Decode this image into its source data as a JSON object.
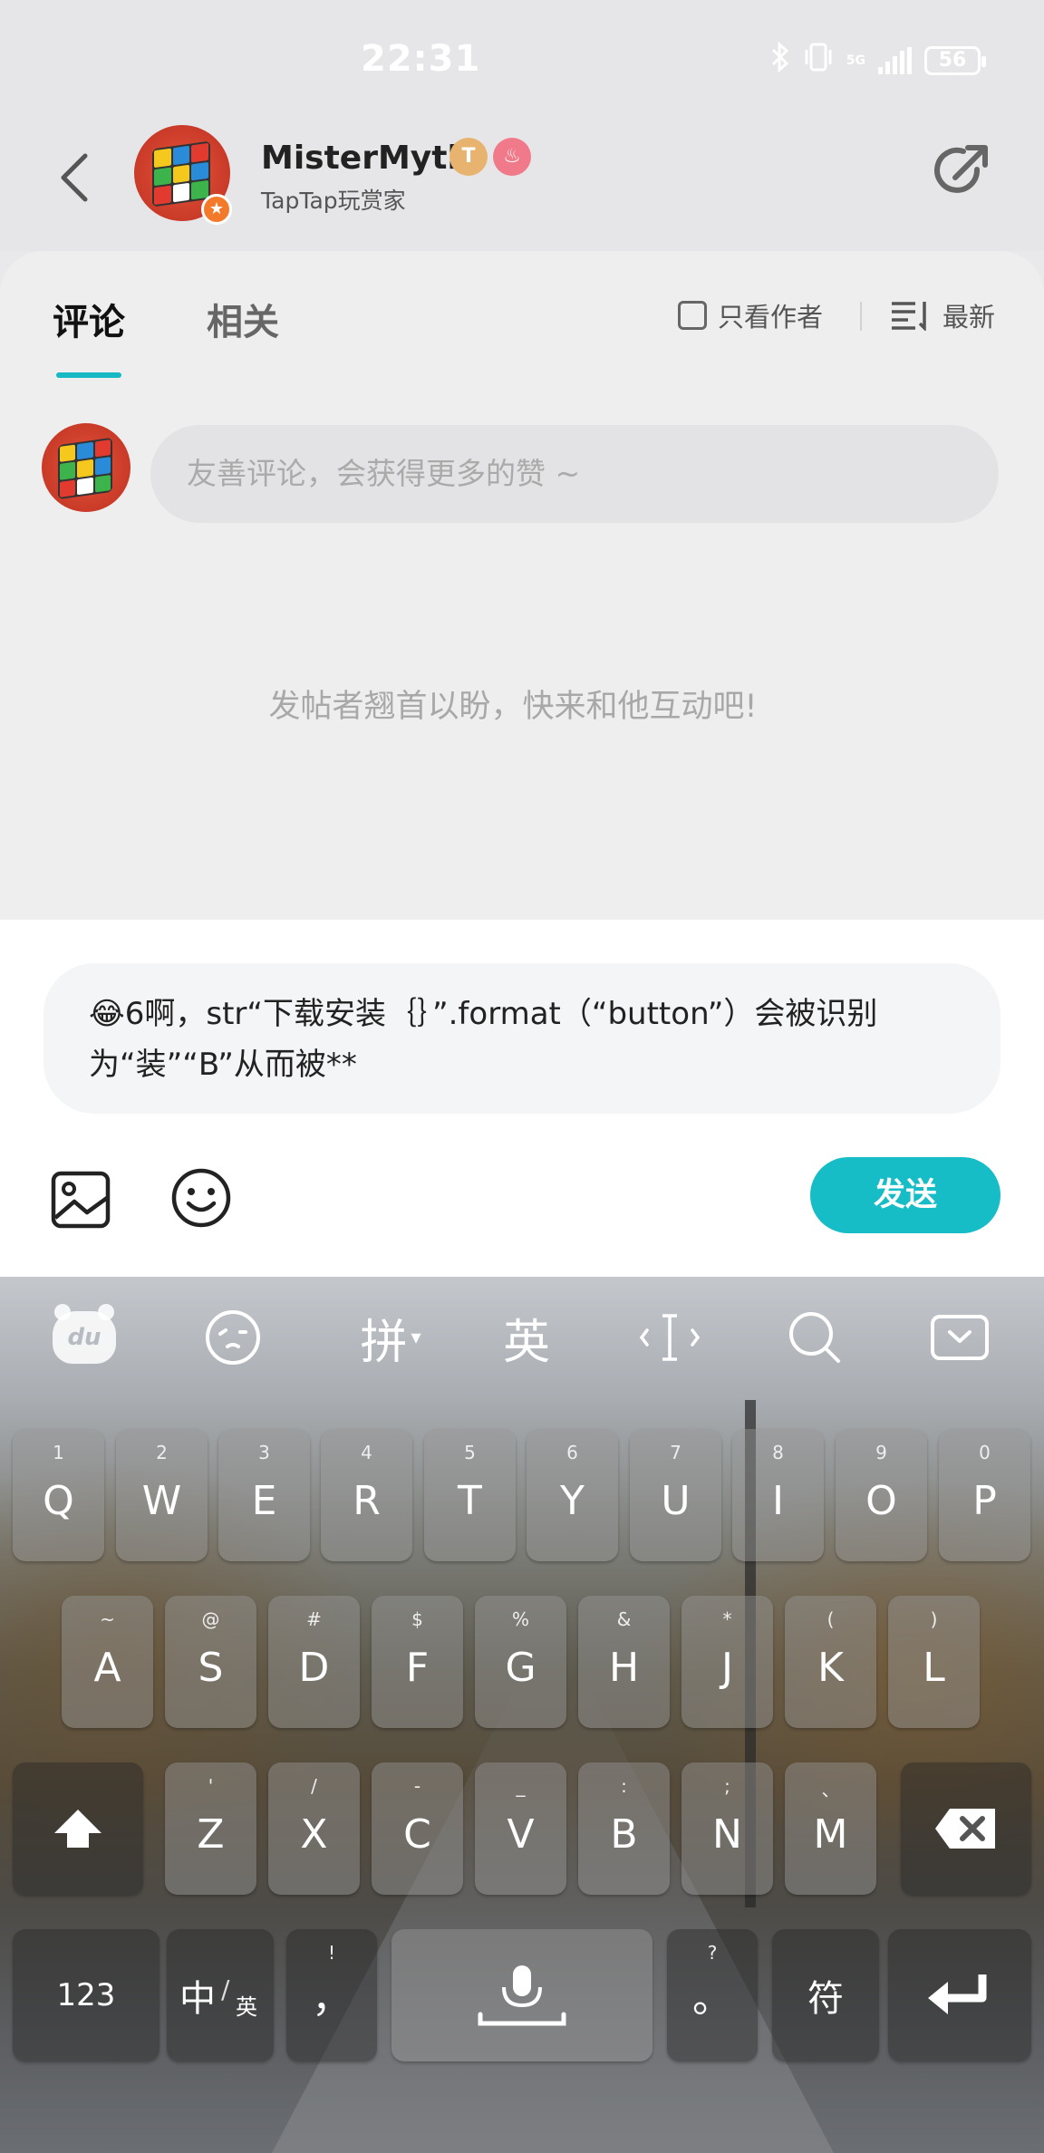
{
  "status_bar": {
    "time": "22:31",
    "network": "5G",
    "battery": "56"
  },
  "header": {
    "username": "MisterMyth",
    "subtitle": "TapTap玩赏家",
    "badge_t": "T",
    "badge_fire": "♨"
  },
  "tabs": {
    "comment": "评论",
    "related": "相关"
  },
  "filters": {
    "only_author": "只看作者",
    "sort": "最新"
  },
  "comment_box": {
    "placeholder": "友善评论，会获得更多的赞 ~"
  },
  "empty_hint": "发帖者翘首以盼，快来和他互动吧!",
  "compose": {
    "text": "😂6啊，str“下载安装｛｝”.format（“button”）会被识别为“装”“B”从而被**",
    "send_label": "发送"
  },
  "keyboard": {
    "toolbar": {
      "du": "du",
      "pinyin": "拼",
      "english": "英"
    },
    "row1": [
      {
        "sub": "1",
        "main": "Q"
      },
      {
        "sub": "2",
        "main": "W"
      },
      {
        "sub": "3",
        "main": "E"
      },
      {
        "sub": "4",
        "main": "R"
      },
      {
        "sub": "5",
        "main": "T"
      },
      {
        "sub": "6",
        "main": "Y"
      },
      {
        "sub": "7",
        "main": "U"
      },
      {
        "sub": "8",
        "main": "I"
      },
      {
        "sub": "9",
        "main": "O"
      },
      {
        "sub": "0",
        "main": "P"
      }
    ],
    "row2": [
      {
        "sub": "~",
        "main": "A"
      },
      {
        "sub": "@",
        "main": "S"
      },
      {
        "sub": "#",
        "main": "D"
      },
      {
        "sub": "$",
        "main": "F"
      },
      {
        "sub": "%",
        "main": "G"
      },
      {
        "sub": "&",
        "main": "H"
      },
      {
        "sub": "*",
        "main": "J"
      },
      {
        "sub": "(",
        "main": "K"
      },
      {
        "sub": ")",
        "main": "L"
      }
    ],
    "row3": [
      {
        "sub": "'",
        "main": "Z"
      },
      {
        "sub": "/",
        "main": "X"
      },
      {
        "sub": "-",
        "main": "C"
      },
      {
        "sub": "_",
        "main": "V"
      },
      {
        "sub": ":",
        "main": "B"
      },
      {
        "sub": ";",
        "main": "N"
      },
      {
        "sub": "、",
        "main": "M"
      }
    ],
    "bottom": {
      "num": "123",
      "zh": "中",
      "en_small": "英",
      "comma_sub": "!",
      "comma": "，",
      "period_sub": "?",
      "period": "。",
      "symbols": "符"
    }
  }
}
